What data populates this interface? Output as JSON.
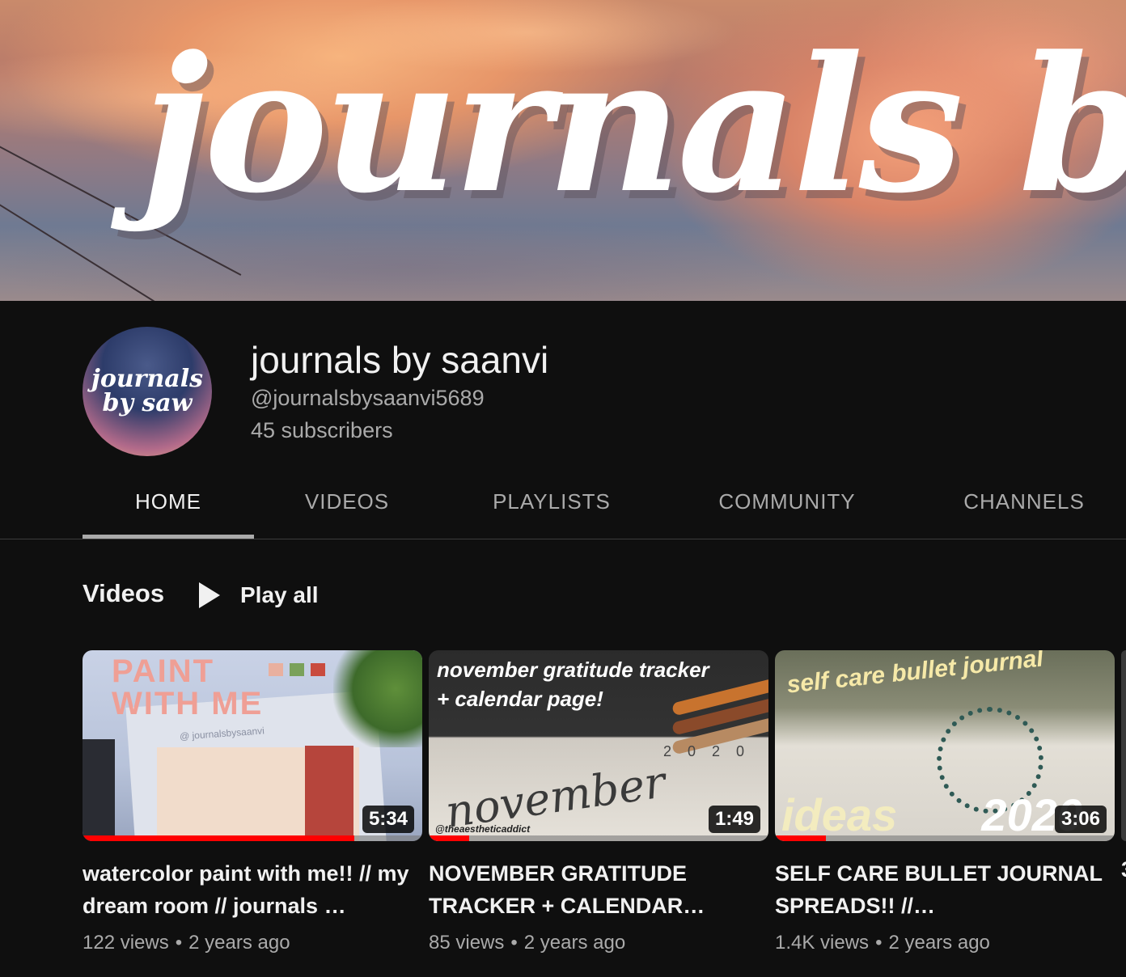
{
  "banner": {
    "title": "journals by"
  },
  "channel": {
    "avatar_text": "journals by saw",
    "name": "journals by saanvi",
    "handle": "@journalsbysaanvi5689",
    "subscribers": "45 subscribers"
  },
  "tabs": [
    {
      "label": "HOME",
      "active": true
    },
    {
      "label": "VIDEOS",
      "active": false
    },
    {
      "label": "PLAYLISTS",
      "active": false
    },
    {
      "label": "COMMUNITY",
      "active": false
    },
    {
      "label": "CHANNELS",
      "active": false
    }
  ],
  "section": {
    "title": "Videos",
    "play_all": "Play all"
  },
  "videos": [
    {
      "title": "watercolor paint with me!! // my dream room // journals …",
      "views": "122 views",
      "age": "2 years ago",
      "duration": "5:34",
      "watched_fraction": 0.8,
      "thumb_text": "PAINT WITH ME",
      "thumb_watermark": "@ journalsbysaanvi"
    },
    {
      "title": "NOVEMBER GRATITUDE TRACKER + CALENDAR…",
      "views": "85 views",
      "age": "2 years ago",
      "duration": "1:49",
      "watched_fraction": 0.12,
      "thumb_text_line1": "november gratitude tracker",
      "thumb_text_line2": "+ calendar page!",
      "thumb_script": "november",
      "thumb_year": "2020",
      "thumb_credit": "@theaestheticaddict"
    },
    {
      "title": "SELF CARE BULLET JOURNAL SPREADS!! //…",
      "views": "1.4K views",
      "age": "2 years ago",
      "duration": "3:06",
      "watched_fraction": 0.15,
      "thumb_text": "self care bullet journal",
      "thumb_ideas": "ideas",
      "thumb_year": "2020"
    }
  ],
  "peek": {
    "title_fragment": "3"
  },
  "colors": {
    "background": "#0f0f0f",
    "progress": "#ff0000",
    "muted_text": "#aaaaaa"
  }
}
